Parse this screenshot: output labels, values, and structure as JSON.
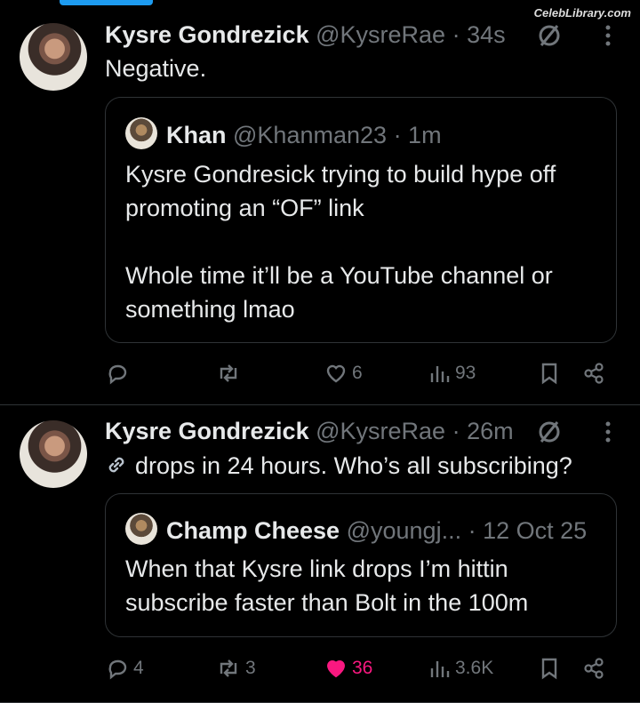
{
  "watermark": "CelebLibrary.com",
  "tweets": [
    {
      "name": "Kysre Gondrezick",
      "handle": "@KysreRae",
      "time": "· 34s",
      "text": "Negative.",
      "quote": {
        "name": "Khan",
        "handle": "@Khanman23",
        "time": "· 1m",
        "lines": [
          "Kysre Gondresick trying to build hype off",
          "promoting an “OF” link",
          "",
          "Whole time it’ll be a YouTube channel or",
          "something lmao"
        ]
      },
      "actions": {
        "replies": "",
        "reposts": "",
        "likes": "6",
        "views": "93"
      }
    },
    {
      "name": "Kysre Gondrezick",
      "handle": "@KysreRae",
      "time": "· 26m",
      "text": "drops in 24 hours. Who’s all subscribing?",
      "quote": {
        "name": "Champ Cheese",
        "handle": "@youngj...",
        "time": "· 12 Oct 25",
        "lines": [
          "When that Kysre link drops I’m hittin",
          "subscribe faster than Bolt in the 100m"
        ]
      },
      "actions": {
        "replies": "4",
        "reposts": "3",
        "likes": "36",
        "views": "3.6K"
      }
    }
  ],
  "colors": {
    "accent": "#1d9bf0",
    "like": "#f91880",
    "muted": "#71767b"
  }
}
